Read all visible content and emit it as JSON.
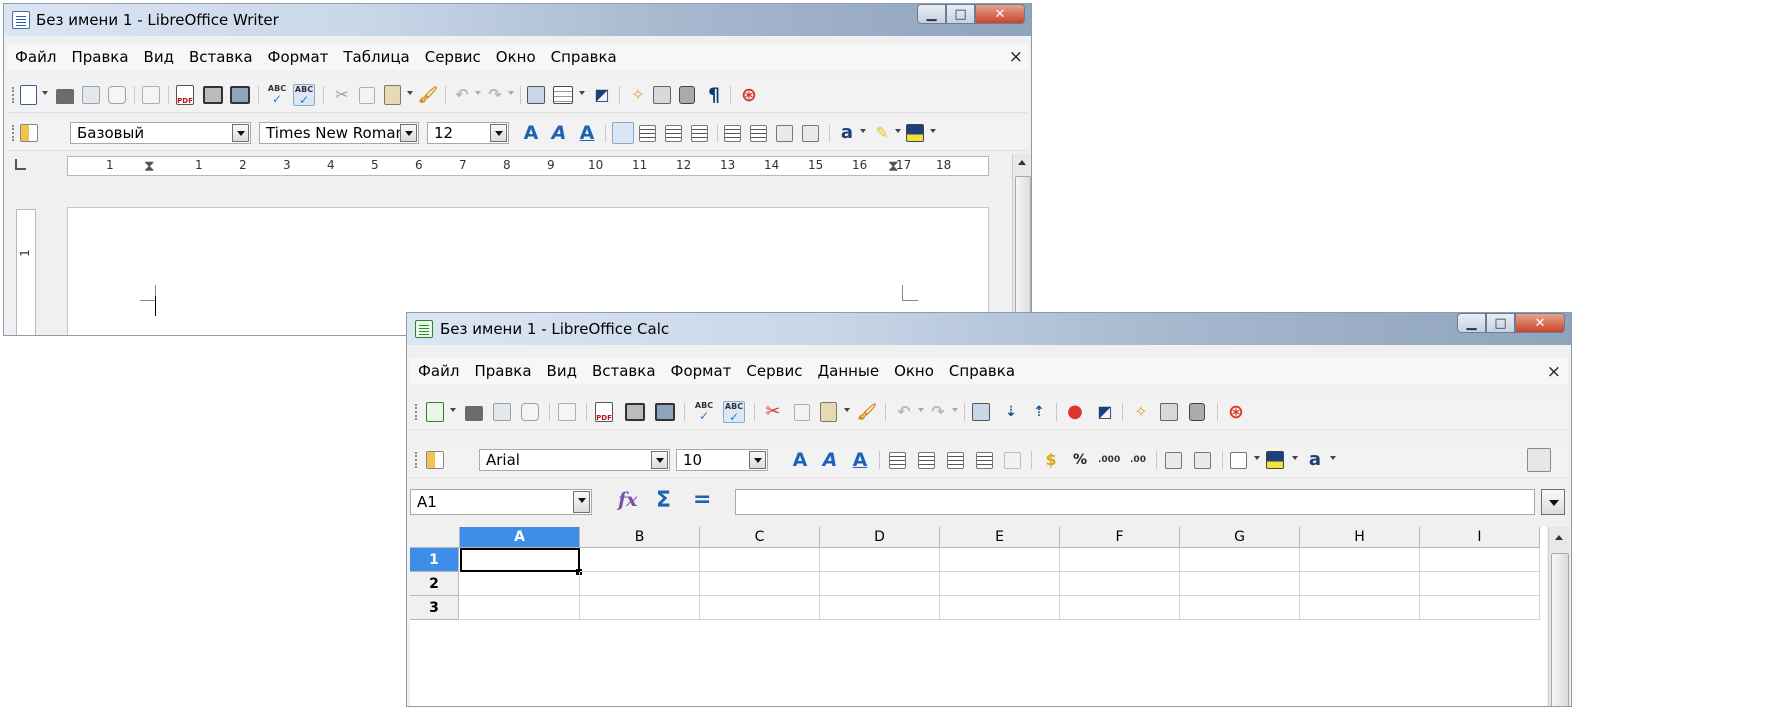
{
  "writer": {
    "title": "Без имени 1 - LibreOffice Writer",
    "menu": [
      "Файл",
      "Правка",
      "Вид",
      "Вставка",
      "Формат",
      "Таблица",
      "Сервис",
      "Окно",
      "Справка"
    ],
    "close_doc": "×",
    "style_value": "Базовый",
    "font_value": "Times New Roman",
    "size_value": "12",
    "ruler_numbers": [
      "1",
      "1",
      "2",
      "3",
      "4",
      "5",
      "6",
      "7",
      "8",
      "9",
      "10",
      "11",
      "12",
      "13",
      "14",
      "15",
      "16",
      "17",
      "18"
    ],
    "vruler_number": "1"
  },
  "calc": {
    "title": "Без имени 1 - LibreOffice Calc",
    "menu": [
      "Файл",
      "Правка",
      "Вид",
      "Вставка",
      "Формат",
      "Сервис",
      "Данные",
      "Окно",
      "Справка"
    ],
    "close_doc": "×",
    "font_value": "Arial",
    "size_value": "10",
    "name_box": "A1",
    "formula_fx": "fx",
    "formula_sum": "Σ",
    "formula_eq": "=",
    "formula_value": "",
    "columns": [
      "A",
      "B",
      "C",
      "D",
      "E",
      "F",
      "G",
      "H",
      "I"
    ],
    "rows": [
      "1",
      "2",
      "3"
    ],
    "selected_cell": "A1"
  },
  "colors": {
    "accent": "#3c8ee8",
    "title_gradient_start": "#dbe6f3",
    "title_gradient_end": "#8fa3bd",
    "close_red": "#c8452a"
  }
}
